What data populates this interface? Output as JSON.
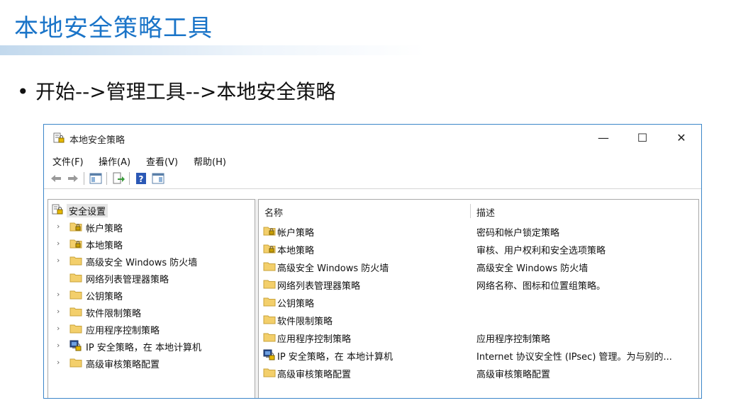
{
  "slide": {
    "title": "本地安全策略工具",
    "bullet": "开始-->管理工具-->本地安全策略",
    "bullet_char": "•"
  },
  "window": {
    "title": "本地安全策略",
    "controls": {
      "minimize": "—",
      "maximize": "☐",
      "close": "✕"
    },
    "menu": [
      "文件(F)",
      "操作(A)",
      "查看(V)",
      "帮助(H)"
    ],
    "toolbar": [
      "back-icon",
      "forward-icon",
      "show-hide-tree-icon",
      "export-list-icon",
      "help-icon",
      "properties-icon"
    ]
  },
  "tree": {
    "root": {
      "label": "安全设置",
      "icon": "security-settings-icon"
    },
    "items": [
      {
        "label": "帐户策略",
        "icon": "policy-folder-icon",
        "expandable": true
      },
      {
        "label": "本地策略",
        "icon": "policy-folder-icon",
        "expandable": true
      },
      {
        "label": "高级安全 Windows 防火墙",
        "icon": "folder-icon",
        "expandable": true
      },
      {
        "label": "网络列表管理器策略",
        "icon": "folder-icon",
        "expandable": false
      },
      {
        "label": "公钥策略",
        "icon": "folder-icon",
        "expandable": true
      },
      {
        "label": "软件限制策略",
        "icon": "folder-icon",
        "expandable": true
      },
      {
        "label": "应用程序控制策略",
        "icon": "folder-icon",
        "expandable": true
      },
      {
        "label": "IP 安全策略，在 本地计算机",
        "icon": "ipsec-icon",
        "expandable": true
      },
      {
        "label": "高级审核策略配置",
        "icon": "folder-icon",
        "expandable": true
      }
    ],
    "chevron": "›"
  },
  "list": {
    "columns": [
      "名称",
      "描述"
    ],
    "rows": [
      {
        "name": "帐户策略",
        "desc": "密码和帐户锁定策略",
        "icon": "policy-folder-icon"
      },
      {
        "name": "本地策略",
        "desc": "审核、用户权利和安全选项策略",
        "icon": "policy-folder-icon"
      },
      {
        "name": "高级安全 Windows 防火墙",
        "desc": "高级安全 Windows 防火墙",
        "icon": "folder-icon"
      },
      {
        "name": "网络列表管理器策略",
        "desc": "网络名称、图标和位置组策略。",
        "icon": "folder-icon"
      },
      {
        "name": "公钥策略",
        "desc": "",
        "icon": "folder-icon"
      },
      {
        "name": "软件限制策略",
        "desc": "",
        "icon": "folder-icon"
      },
      {
        "name": "应用程序控制策略",
        "desc": "应用程序控制策略",
        "icon": "folder-icon"
      },
      {
        "name": "IP 安全策略，在 本地计算机",
        "desc": "Internet 协议安全性 (IPsec) 管理。为与别的...",
        "icon": "ipsec-icon"
      },
      {
        "name": "高级审核策略配置",
        "desc": "高级审核策略配置",
        "icon": "folder-icon"
      }
    ]
  },
  "colors": {
    "title_blue": "#1a74c8",
    "window_border": "#3c86c9",
    "folder_yellow": "#f3cf6b",
    "selection_gray": "#e5e5e5"
  }
}
